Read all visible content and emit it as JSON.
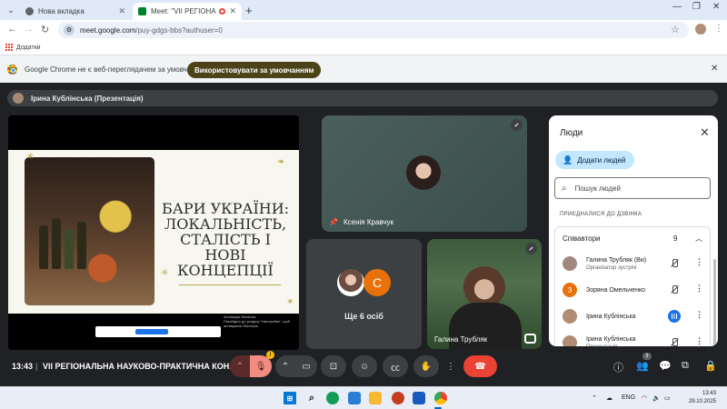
{
  "browser": {
    "tabs": [
      {
        "title": "Нова вкладка",
        "favicon_color": "#5f6368",
        "active": false
      },
      {
        "title": "Meet: \"VII РЕГІОНАЛЬНА НА",
        "favicon_color": "#00832d",
        "active": true,
        "recording": true
      }
    ],
    "new_tab_icon": "plus-icon",
    "address": {
      "host": "meet.google.com",
      "path": "/puy-gdgs-bbs?authuser=0"
    },
    "bookmarks_label": "Додатки",
    "infobar": {
      "message": "Google Chrome не є веб-переглядачем за умовчанням",
      "button": "Використовувати за умовчанням"
    }
  },
  "meet": {
    "presenter_bar": "Ірина Кублінська (Презентація)",
    "slide": {
      "title": "БАРИ УКРАЇНИ: ЛОКАЛЬНІСТЬ, СТАЛІСТЬ І НОВІ КОНЦЕПЦІЇ",
      "watermark_line1": "Активація Windows",
      "watermark_line2": "Перейдіть до розділу \"Настройки\", щоб",
      "watermark_line3": "активувати Windows."
    },
    "tiles": {
      "ksenia": "Ксенія Кравчук",
      "more_initial": "C",
      "more_label": "Ще 6 осіб",
      "galyna": "Галина Трубляк"
    },
    "people": {
      "title": "Люди",
      "add_button": "Додати людей",
      "search_placeholder": "Пошук людей",
      "joined_header": "ПРИЄДНАЛИСЯ ДО ДЗВІНКА",
      "group_label": "Співавтори",
      "group_count": "9",
      "participants": [
        {
          "name": "Галина Трубляк (Ви)",
          "role": "Організатор зустрічі",
          "avatar_color": "#a1887f",
          "initial": "",
          "mic": "off"
        },
        {
          "name": "Зоряна Омельченко",
          "role": "",
          "avatar_color": "#e8710a",
          "initial": "З",
          "mic": "off"
        },
        {
          "name": "Ірина Кублінська",
          "role": "",
          "avatar_color": "#b08d74",
          "initial": "",
          "mic": "speaking"
        },
        {
          "name": "Ірина Кублінська",
          "role": "Презентація",
          "avatar_color": "#b08d74",
          "initial": "",
          "mic": "off"
        }
      ]
    },
    "controls": {
      "time": "13:43",
      "separator": "|",
      "meeting_title": "VII РЕГІОНАЛЬНА НАУКОВО-ПРАКТИЧНА КОН...",
      "people_badge": "9",
      "mic_warning": "!"
    }
  },
  "taskbar": {
    "language": "ENG",
    "time": "13:43",
    "date": "29.10.2025"
  },
  "colors": {
    "meet_bg": "#202124",
    "accent_blue": "#1a73e8",
    "hangup_red": "#ea4335",
    "add_people_bg": "#c2e7ff"
  }
}
